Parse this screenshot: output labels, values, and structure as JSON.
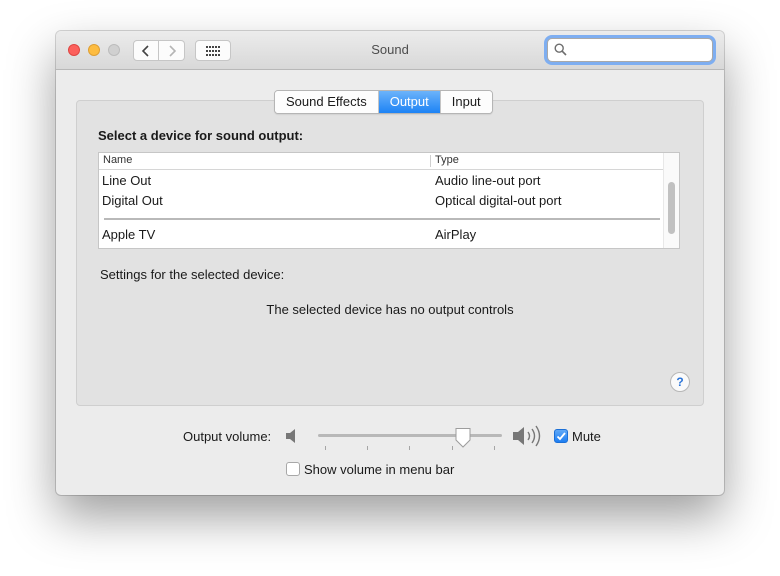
{
  "window": {
    "title": "Sound",
    "search_placeholder": "",
    "controls": [
      "close",
      "minimize",
      "zoom"
    ],
    "icons": {
      "back": "chevron-left-icon",
      "forward": "chevron-right-icon",
      "show_all": "grid-icon",
      "search": "search-icon"
    }
  },
  "tabs": [
    {
      "label": "Sound Effects",
      "active": false
    },
    {
      "label": "Output",
      "active": true
    },
    {
      "label": "Input",
      "active": false
    }
  ],
  "output": {
    "select_label": "Select a device for sound output:",
    "columns": {
      "name": "Name",
      "type": "Type"
    },
    "devices": [
      {
        "name": "Line Out",
        "type": "Audio line-out port"
      },
      {
        "name": "Digital Out",
        "type": "Optical digital-out port"
      },
      {
        "name": "Apple TV",
        "type": "AirPlay"
      }
    ],
    "settings_label": "Settings for the selected device:",
    "no_controls_text": "The selected device has no output controls",
    "help_label": "?"
  },
  "volume": {
    "label": "Output volume:",
    "level": 0.79,
    "mute_label": "Mute",
    "muted": true,
    "menu_bar_label": "Show volume in menu bar",
    "show_in_menu_bar": false
  },
  "colors": {
    "accent": "#1d83f5",
    "close": "#fc605c",
    "minimize": "#fdbc40",
    "zoom_disabled": "#d0d0d0"
  }
}
